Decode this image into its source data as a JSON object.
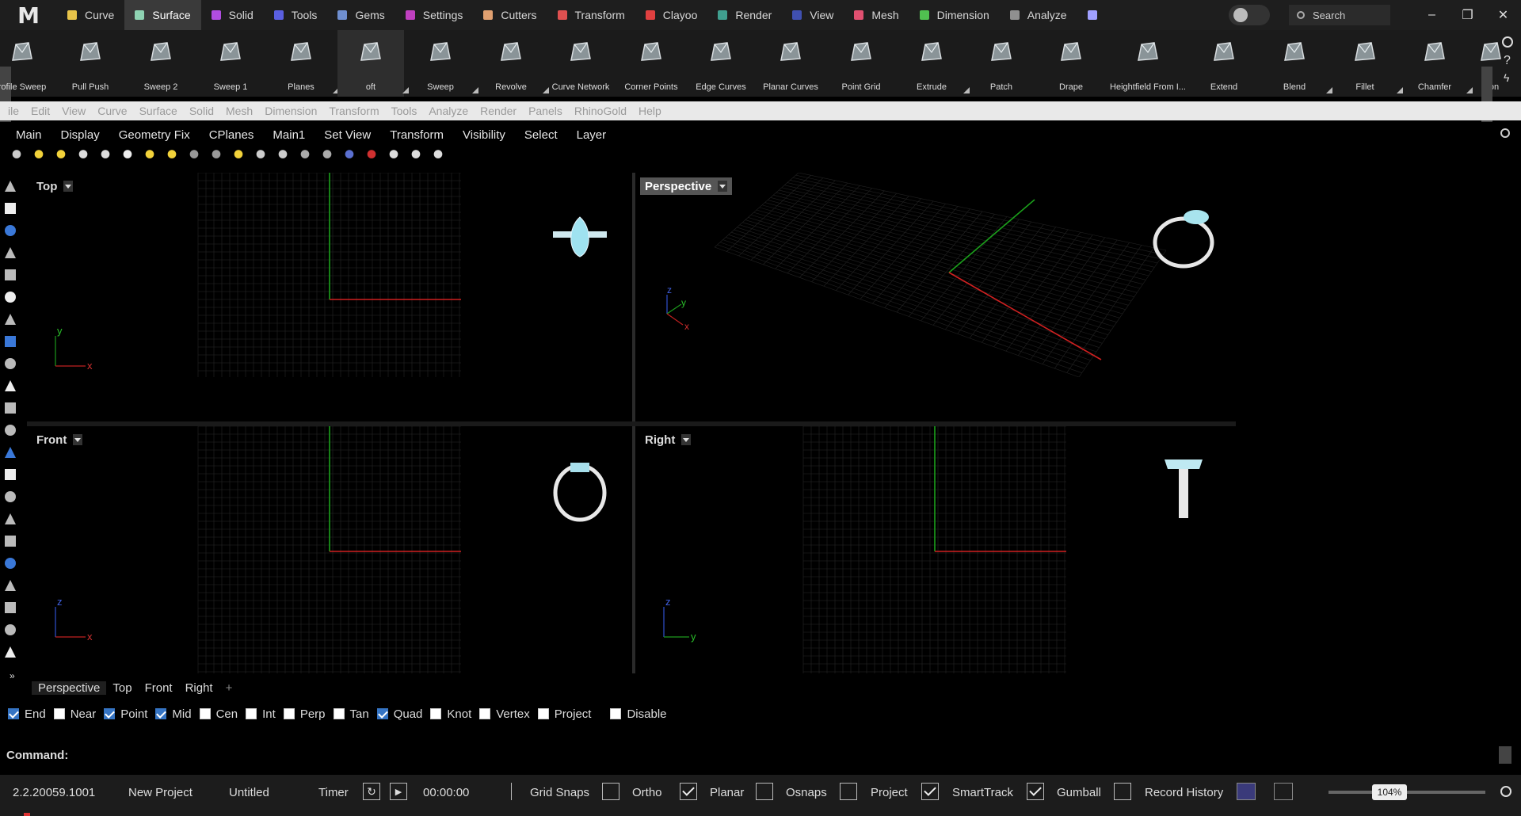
{
  "app": {
    "logo_text": "M"
  },
  "tabs": [
    {
      "label": "Curve",
      "color": "#e8c44a"
    },
    {
      "label": "Surface",
      "color": "#8fd3b3"
    },
    {
      "label": "Solid",
      "color": "#b04de0"
    },
    {
      "label": "Tools",
      "color": "#5a5fe0"
    },
    {
      "label": "Gems",
      "color": "#6f8fd0"
    },
    {
      "label": "Settings",
      "color": "#c040c0"
    },
    {
      "label": "Cutters",
      "color": "#e0a070"
    },
    {
      "label": "Transform",
      "color": "#e05050"
    },
    {
      "label": "Clayoo",
      "color": "#e04040"
    },
    {
      "label": "Render",
      "color": "#40a090"
    },
    {
      "label": "View",
      "color": "#4050b0"
    },
    {
      "label": "Mesh",
      "color": "#e05070"
    },
    {
      "label": "Dimension",
      "color": "#50c050"
    },
    {
      "label": "Analyze",
      "color": "#909090"
    },
    {
      "label": "",
      "color": "#a0a0ff"
    }
  ],
  "active_tab_index": 1,
  "search": {
    "placeholder": "Search"
  },
  "window": {
    "minimize": "–",
    "restore": "❐",
    "close": "✕"
  },
  "ribbon": [
    {
      "label": "rofile Sweep",
      "icon": "profile-sweep-icon"
    },
    {
      "label": "Pull Push",
      "icon": "pull-push-icon"
    },
    {
      "label": "Sweep 2",
      "icon": "sweep2-icon"
    },
    {
      "label": "Sweep 1",
      "icon": "sweep1-icon"
    },
    {
      "label": "Planes",
      "icon": "planes-icon"
    },
    {
      "label": "oft",
      "icon": "loft-icon"
    },
    {
      "label": "Sweep",
      "icon": "sweep-icon"
    },
    {
      "label": "Revolve",
      "icon": "revolve-icon"
    },
    {
      "label": "Curve Network",
      "icon": "curve-network-icon"
    },
    {
      "label": "Corner Points",
      "icon": "corner-points-icon"
    },
    {
      "label": "Edge Curves",
      "icon": "edge-curves-icon"
    },
    {
      "label": "Planar Curves",
      "icon": "planar-curves-icon"
    },
    {
      "label": "Point Grid",
      "icon": "point-grid-icon"
    },
    {
      "label": "Extrude",
      "icon": "extrude-icon"
    },
    {
      "label": "Patch",
      "icon": "patch-icon"
    },
    {
      "label": "Drape",
      "icon": "drape-icon"
    },
    {
      "label": "Heightfield From I...",
      "icon": "heightfield-icon"
    },
    {
      "label": "Extend",
      "icon": "extend-icon"
    },
    {
      "label": "Blend",
      "icon": "blend-icon"
    },
    {
      "label": "Fillet",
      "icon": "fillet-icon"
    },
    {
      "label": "Chamfer",
      "icon": "chamfer-icon"
    },
    {
      "label": "Con",
      "icon": "con-icon"
    }
  ],
  "menu": [
    "ile",
    "Edit",
    "View",
    "Curve",
    "Surface",
    "Solid",
    "Mesh",
    "Dimension",
    "Transform",
    "Tools",
    "Analyze",
    "Render",
    "Panels",
    "RhinoGold",
    "Help"
  ],
  "toolbar_tabs": [
    "Main",
    "Display",
    "Geometry Fix",
    "CPlanes",
    "Main1",
    "Set View",
    "Transform",
    "Visibility",
    "Select",
    "Layer"
  ],
  "viewports": {
    "top": {
      "label": "Top",
      "axis_a": "y",
      "axis_b": "x"
    },
    "perspective": {
      "label": "Perspective",
      "axis_a": "z",
      "axis_b": "y",
      "axis_c": "x"
    },
    "front": {
      "label": "Front",
      "axis_a": "z",
      "axis_b": "x"
    },
    "right": {
      "label": "Right",
      "axis_a": "z",
      "axis_b": "y"
    }
  },
  "view_tabs": [
    "Perspective",
    "Top",
    "Front",
    "Right"
  ],
  "view_tab_add": "+",
  "osnaps": [
    {
      "label": "End",
      "checked": true
    },
    {
      "label": "Near",
      "checked": false
    },
    {
      "label": "Point",
      "checked": true
    },
    {
      "label": "Mid",
      "checked": true
    },
    {
      "label": "Cen",
      "checked": false
    },
    {
      "label": "Int",
      "checked": false
    },
    {
      "label": "Perp",
      "checked": false
    },
    {
      "label": "Tan",
      "checked": false
    },
    {
      "label": "Quad",
      "checked": true
    },
    {
      "label": "Knot",
      "checked": false
    },
    {
      "label": "Vertex",
      "checked": false
    },
    {
      "label": "Project",
      "checked": false
    },
    {
      "label": "Disable",
      "checked": false
    }
  ],
  "command": {
    "label": "Command:"
  },
  "status": {
    "version": "2.2.20059.1001",
    "project": "New Project",
    "file": "Untitled",
    "timer_label": "Timer",
    "timer_value": "00:00:00",
    "toggles": [
      {
        "label": "Grid Snaps",
        "checked": false
      },
      {
        "label": "Ortho",
        "checked": false
      },
      {
        "label": "Planar",
        "checked": true
      },
      {
        "label": "Osnaps",
        "checked": false
      },
      {
        "label": "Project",
        "checked": false
      },
      {
        "label": "SmartTrack",
        "checked": true
      },
      {
        "label": "Gumball",
        "checked": true
      },
      {
        "label": "Record History",
        "checked": false
      }
    ],
    "zoom": "104%"
  }
}
